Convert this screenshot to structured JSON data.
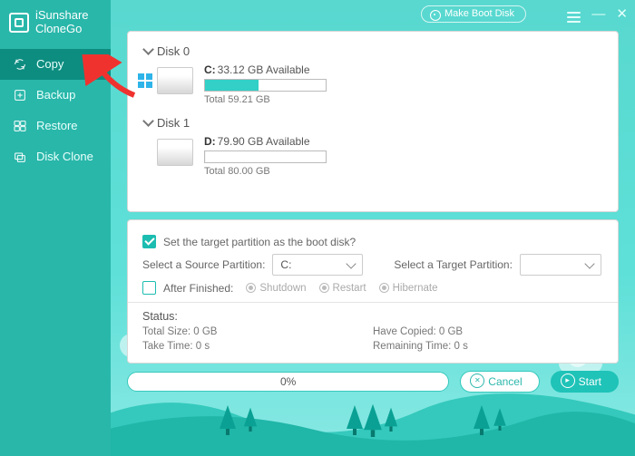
{
  "app": {
    "vendor": "iSunshare",
    "name": "CloneGo"
  },
  "header": {
    "make_boot_disk": "Make Boot Disk"
  },
  "sidebar": {
    "items": [
      {
        "label": "Copy",
        "icon": "sync-icon"
      },
      {
        "label": "Backup",
        "icon": "backup-icon"
      },
      {
        "label": "Restore",
        "icon": "restore-icon"
      },
      {
        "label": "Disk Clone",
        "icon": "clone-icon"
      }
    ],
    "active_index": 0
  },
  "disks": [
    {
      "title": "Disk 0",
      "partitions": [
        {
          "letter": "C:",
          "available": "33.12 GB Available",
          "total": "Total 59.21 GB",
          "os": true,
          "used_pct": 44
        }
      ]
    },
    {
      "title": "Disk 1",
      "partitions": [
        {
          "letter": "D:",
          "available": "79.90 GB Available",
          "total": "Total 80.00 GB",
          "os": false,
          "used_pct": 0
        }
      ]
    }
  ],
  "settings": {
    "boot_checkbox_label": "Set the target partition as the boot disk?",
    "boot_checkbox_checked": true,
    "source_label": "Select a Source Partition:",
    "source_value": "C:",
    "target_label": "Select a Target Partition:",
    "target_value": "",
    "after_finished_label": "After Finished:",
    "after_finished_checked": false,
    "after_options": [
      "Shutdown",
      "Restart",
      "Hibernate"
    ]
  },
  "status": {
    "title": "Status:",
    "total_size": "Total Size: 0 GB",
    "have_copied": "Have Copied: 0 GB",
    "take_time": "Take Time: 0 s",
    "remaining": "Remaining Time: 0 s"
  },
  "footer": {
    "progress_text": "0%",
    "cancel": "Cancel",
    "start": "Start"
  }
}
